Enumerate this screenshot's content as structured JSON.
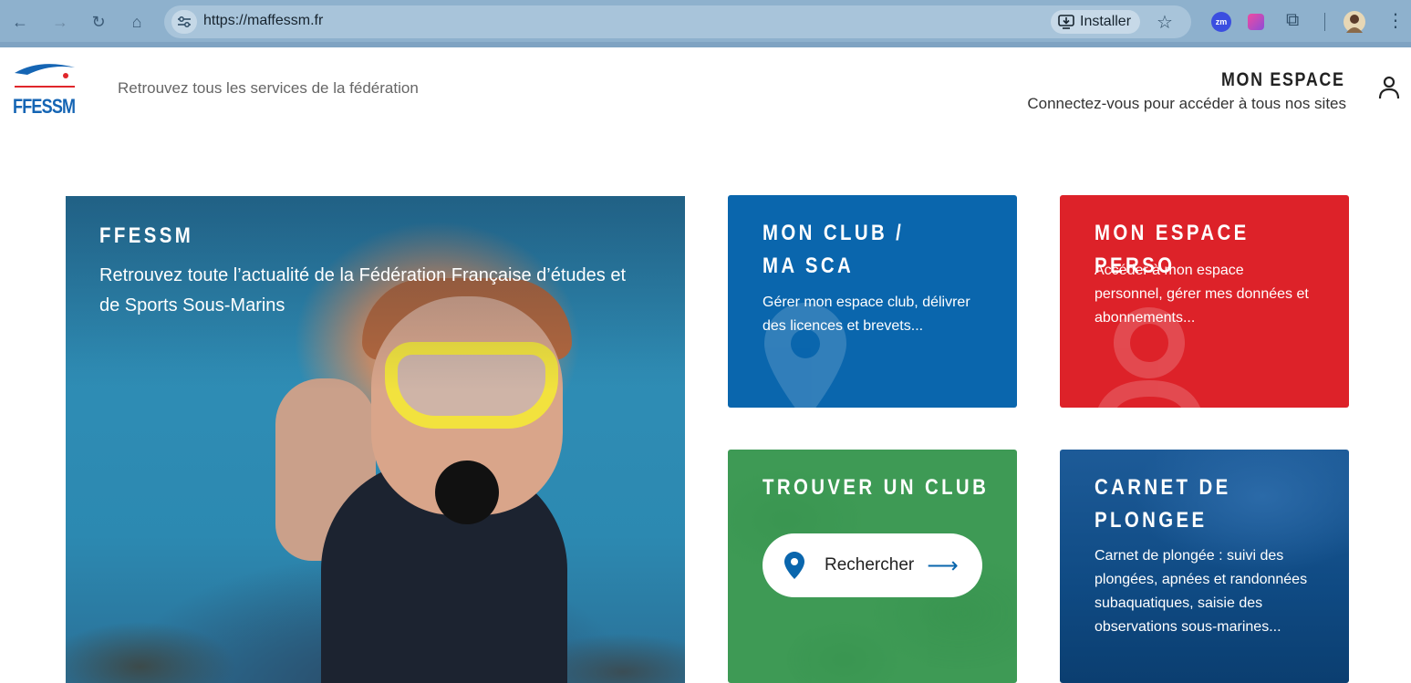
{
  "browser": {
    "url": "https://maffessm.fr",
    "install_label": "Installer",
    "ext_zm": "zm"
  },
  "header": {
    "logo_text": "FFESSM",
    "tagline": "Retrouvez tous les services de la fédération",
    "account_title": "MON ESPACE",
    "account_subtitle": "Connectez-vous pour accéder à tous nos sites"
  },
  "hero": {
    "title": "FFESSM",
    "description": "Retrouvez toute l’actualité de la Fédération Française d’études et de Sports Sous-Marins"
  },
  "cards": {
    "club": {
      "title_line1": "MON CLUB /",
      "title_line2": "MA SCA",
      "description": "Gérer mon espace club, délivrer des licences et brevets..."
    },
    "perso": {
      "title": "MON ESPACE PERSO",
      "description": "Accéder à mon espace personnel, gérer mes données et abonnements..."
    },
    "find_club": {
      "title": "TROUVER UN CLUB",
      "search_label": "Rechercher"
    },
    "carnet": {
      "title_line1": "CARNET DE",
      "title_line2": "PLONGEE",
      "description": "Carnet de plongée : suivi des plongées, apnées et randonnées subaquatiques, saisie des observations sous-marines..."
    }
  },
  "colors": {
    "brand_blue": "#0a66ad",
    "perso_red": "#dd2229",
    "find_green": "#3e9a55",
    "carnet_navy": "#0f4a83"
  }
}
